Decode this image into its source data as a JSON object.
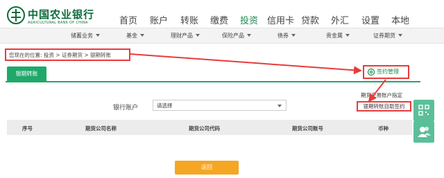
{
  "header": {
    "logo_cn": "中国农业银行",
    "logo_en": "AGRICULTURAL BANK OF CHINA"
  },
  "mainnav": [
    {
      "label": "首页"
    },
    {
      "label": "账户"
    },
    {
      "label": "转账"
    },
    {
      "label": "缴费"
    },
    {
      "label": "投资"
    },
    {
      "label": "信用卡"
    },
    {
      "label": "贷款"
    },
    {
      "label": "外汇"
    },
    {
      "label": "设置"
    },
    {
      "label": "本地"
    }
  ],
  "subnav": [
    {
      "label": "储蓄业务"
    },
    {
      "label": "基金"
    },
    {
      "label": "理财产品"
    },
    {
      "label": "保险产品"
    },
    {
      "label": "债券"
    },
    {
      "label": "贵金属"
    },
    {
      "label": "证券期货"
    }
  ],
  "breadcrumb": "您现在的位置: 投资 > 证券期货 > 银期转账",
  "tab_label": "银期转账",
  "sign_management": "签约管理",
  "futures_designate": "期货交易账户指定",
  "self_sign": "银期转账自助签约",
  "account": {
    "label": "银行账户",
    "selected": "请选择"
  },
  "table": {
    "headers": [
      "序号",
      "期货公司名称",
      "期货公司代码",
      "期货公司账号",
      "币种"
    ],
    "rows": []
  },
  "return_button": "返回",
  "colors": {
    "brand_green": "#0a6b3a",
    "tab_green": "#1fa86a",
    "annotation_red": "#e83a3a",
    "return_orange": "#f5a623",
    "side_green": "#5bbf9a"
  },
  "icons": {
    "logo": "abc-logo-icon",
    "gear": "gear-icon",
    "qr": "qr-code-icon",
    "user": "user-group-icon"
  }
}
